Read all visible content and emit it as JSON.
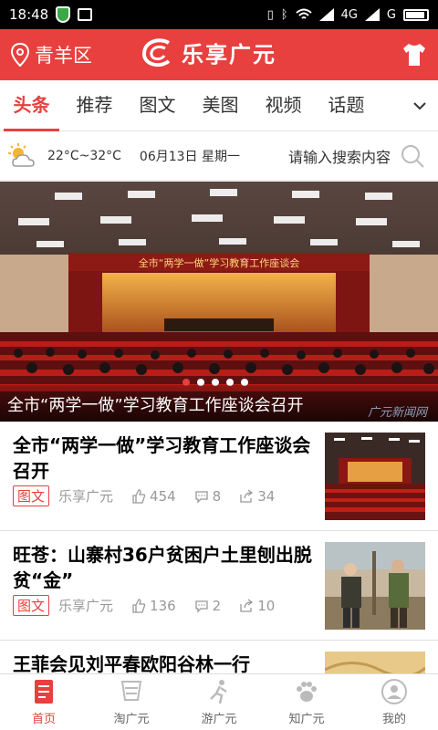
{
  "status_bar": {
    "time": "18:48",
    "network": "4G",
    "network2": "G"
  },
  "header": {
    "location": "青羊区",
    "app_name": "乐享广元"
  },
  "tabs": [
    {
      "label": "头条"
    },
    {
      "label": "推荐"
    },
    {
      "label": "图文"
    },
    {
      "label": "美图"
    },
    {
      "label": "视频"
    },
    {
      "label": "话题"
    }
  ],
  "info_bar": {
    "temperature": "22°C~32°C",
    "date": "06月13日 星期一",
    "search_placeholder": "请输入搜索内容"
  },
  "hero": {
    "banner_text": "全市“两学一做”学习教育工作座谈会",
    "caption": "全市“两学一做”学习教育工作座谈会召开",
    "watermark": "广元新闻网",
    "slide_count": 5,
    "active_slide": 1
  },
  "news": [
    {
      "title": "全市“两学一做”学习教育工作座谈会召开",
      "tag": "图文",
      "source": "乐享广元",
      "likes": "454",
      "comments": "8",
      "shares": "34",
      "thumb": "meeting"
    },
    {
      "title": "旺苍：山寨村36户贫困户土里刨出脱贫“金”",
      "tag": "图文",
      "source": "乐享广元",
      "likes": "136",
      "comments": "2",
      "shares": "10",
      "thumb": "farmers"
    },
    {
      "title": "王菲会见刘平春欧阳谷林一行",
      "thumb": "partial"
    }
  ],
  "bottom_nav": [
    {
      "label": "首页",
      "icon": "home-doc-icon"
    },
    {
      "label": "淘广元",
      "icon": "shop-icon"
    },
    {
      "label": "游广元",
      "icon": "travel-icon"
    },
    {
      "label": "知广元",
      "icon": "paw-icon"
    },
    {
      "label": "我的",
      "icon": "user-icon"
    }
  ],
  "colors": {
    "brand": "#e8403f"
  }
}
